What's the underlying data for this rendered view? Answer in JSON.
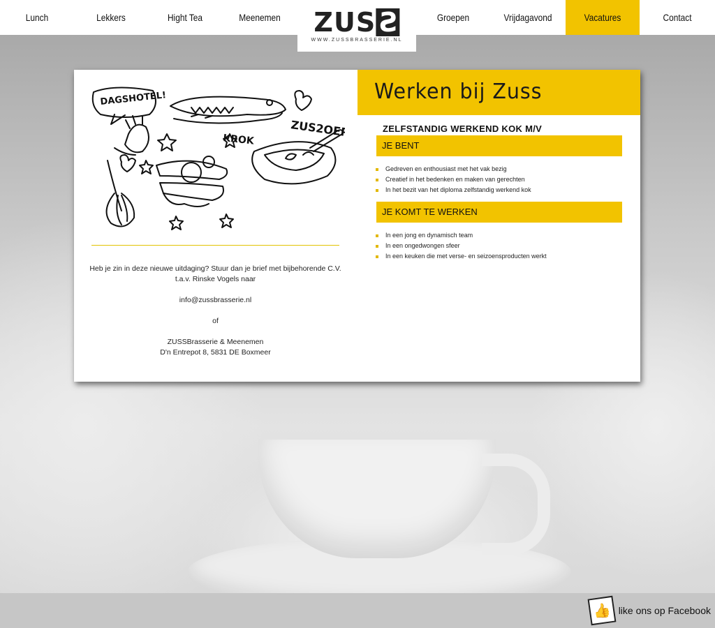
{
  "nav": {
    "items": [
      "Lunch",
      "Lekkers",
      "Hight Tea",
      "Meenemen",
      "Groepen",
      "Vrijdagavond",
      "Vacatures",
      "Contact"
    ],
    "active": "Vacatures"
  },
  "logo": {
    "text_main": "ZUS",
    "text_box": "S",
    "url": "WWW.ZUSSBRASSERIE.NL"
  },
  "doodle": {
    "speech": "DAGSHOTEL!",
    "croc": "KROK",
    "soup": "ZUS2OEP"
  },
  "contact": {
    "line1": "Heb je zin in deze nieuwe uitdaging? Stuur dan je brief met bijbehorende C.V. t.a.v. Rinske Vogels naar",
    "email": "info@zussbrasserie.nl",
    "or": "of",
    "company": "ZUSSBrasserie & Meenemen",
    "address": "D'n Entrepot 8, 5831 DE Boxmeer"
  },
  "vacancy": {
    "heading": "Werken bij Zuss",
    "title": "ZELFSTANDIG WERKEND KOK M/V",
    "section1": "JE BENT",
    "list1": [
      "Gedreven en enthousiast met het vak bezig",
      "Creatief in het bedenken en maken van gerechten",
      "In het bezit van het diploma zelfstandig werkend kok"
    ],
    "section2": "JE KOMT TE WERKEN",
    "list2": [
      "In een jong en dynamisch team",
      "In een ongedwongen sfeer",
      "In een keuken die met verse- en seizoensproducten werkt"
    ]
  },
  "footer": {
    "facebook_label": "like ons op Facebook",
    "facebook_icon": "thumbs-up-icon"
  },
  "colors": {
    "accent": "#f2c300",
    "text": "#111111"
  }
}
